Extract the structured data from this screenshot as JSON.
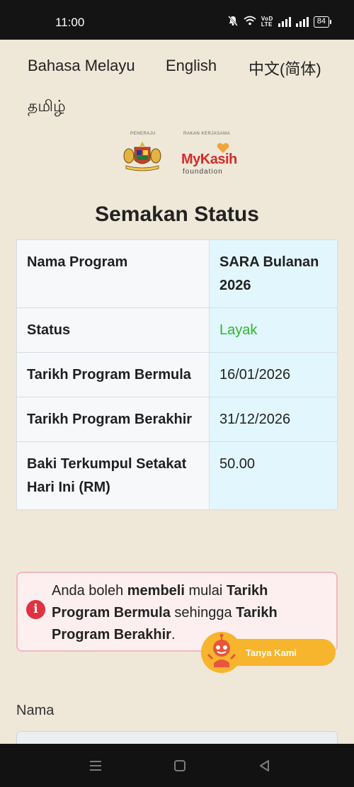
{
  "status_bar": {
    "time": "11:00",
    "battery": "84",
    "volte_top": "VoD",
    "volte_bottom": "LTE",
    "icons": [
      "mute-bell-icon",
      "wifi-icon",
      "volte-icon",
      "signal-icon",
      "signal-icon",
      "battery-icon"
    ]
  },
  "languages": [
    "Bahasa Melayu",
    "English",
    "中文(简体)",
    "தமிழ்"
  ],
  "logos": {
    "left_label": "PENERAJU",
    "right_label": "RAKAN KERJASAMA",
    "right_brand": "MyKasih",
    "right_sub": "foundation"
  },
  "page_title": "Semakan Status",
  "table": {
    "rows": [
      {
        "label": "Nama Program",
        "value": "SARA Bulanan 2026"
      },
      {
        "label": "Status",
        "value": "Layak"
      },
      {
        "label": "Tarikh Program Bermula",
        "value": "16/01/2026"
      },
      {
        "label": "Tarikh Program Berakhir",
        "value": "31/12/2026"
      },
      {
        "label": "Baki Terkumpul Setakat Hari Ini (RM)",
        "value": "50.00"
      }
    ],
    "status_color": "#2eb62c",
    "value_bg": "#e2f7fd"
  },
  "alert": {
    "icon": "info-icon",
    "parts": [
      "Anda boleh ",
      "membeli",
      " mulai ",
      "Tarikh Program Bermula",
      " sehingga ",
      "Tarikh Program Berakhir",
      "."
    ]
  },
  "chat": {
    "label": "Tanya Kami",
    "color": "#f7b52d"
  },
  "form": {
    "name_label": "Nama",
    "name_value": ""
  },
  "nav": {
    "icons": [
      "menu-icon",
      "home-icon",
      "back-icon"
    ]
  }
}
